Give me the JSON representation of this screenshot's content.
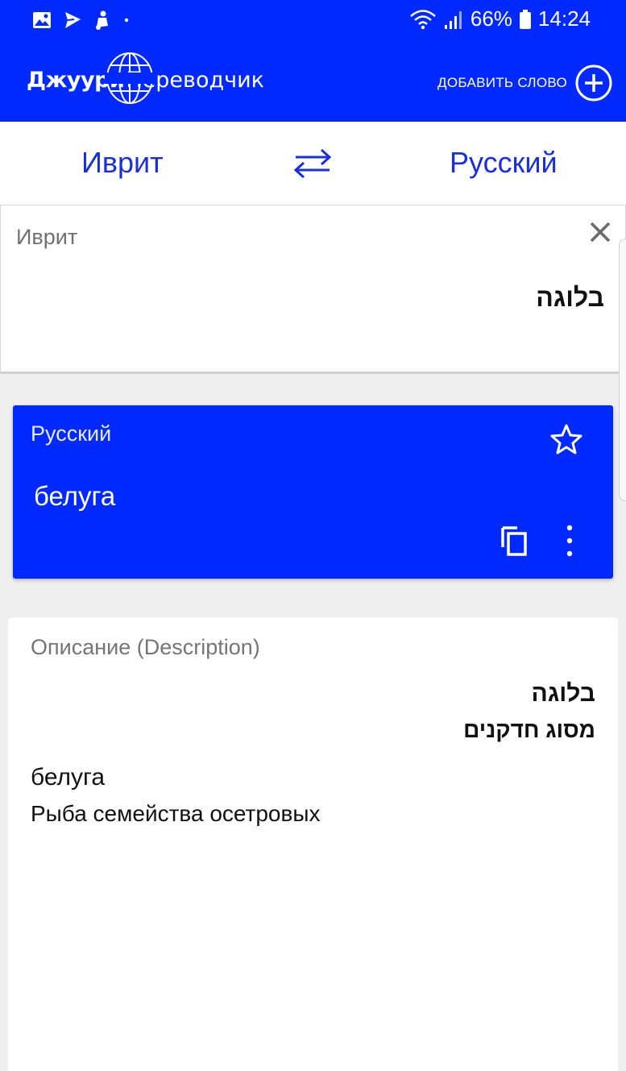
{
  "status_bar": {
    "battery_percent": "66%",
    "time": "14:24"
  },
  "header": {
    "brand_bold": "Джуури",
    "brand_light": "Переводчик",
    "add_word_label": "ДОБАВИТЬ СЛОВО"
  },
  "languages": {
    "source": "Иврит",
    "target": "Русский"
  },
  "input": {
    "label": "Иврит",
    "value": "בלוגה"
  },
  "translation": {
    "label": "Русский",
    "value": "белуга"
  },
  "description": {
    "title": "Описание (Description)",
    "hebrew_word": "בלוגה",
    "hebrew_definition": "מסוג חדקנים",
    "russian_word": "белуга",
    "russian_definition": "Рыба семейства осетровых"
  },
  "colors": {
    "primary": "#0029ff",
    "language_text": "#1a2fd8",
    "background": "#efefef"
  },
  "icons": {
    "status_left": [
      "gallery-icon",
      "send-icon",
      "notification-icon",
      "dot-icon"
    ],
    "status_right": [
      "wifi-icon",
      "signal-icon",
      "battery-icon"
    ],
    "header": [
      "globe-icon",
      "add-circle-icon"
    ],
    "language_row": [
      "swap-arrows-icon"
    ],
    "input": [
      "close-icon"
    ],
    "translation": [
      "star-outline-icon",
      "copy-icon",
      "more-vertical-icon"
    ]
  }
}
